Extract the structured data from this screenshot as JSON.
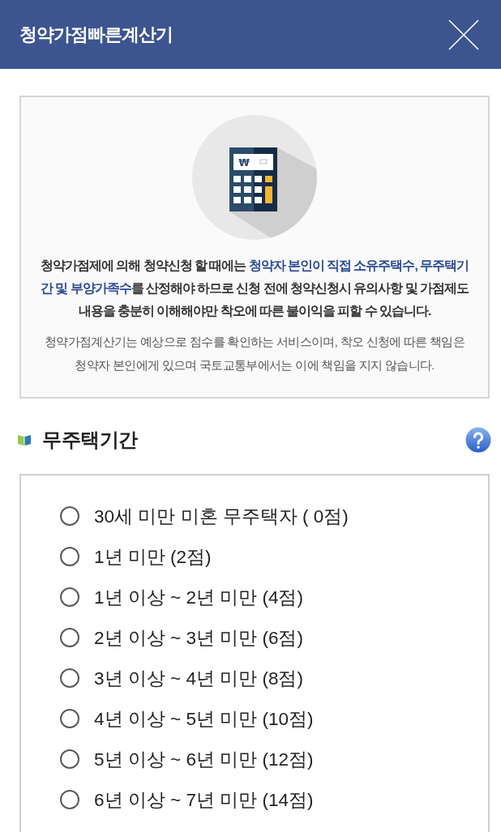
{
  "header": {
    "title": "청약가점빠른계산기"
  },
  "info": {
    "icon_symbol": "₩",
    "intro": {
      "segments": [
        {
          "text": "청약가점제에 의해 청약신청 할 때에는 ",
          "highlight": false
        },
        {
          "text": "청약자 본인이 직접 소유주택수, 무주택기간 및 부양가족수",
          "highlight": true
        },
        {
          "text": "를 산정해야 하므로 신청 전에 청약신청시 유의사항 및 가점제도 내용을 충분히 이해해야만 착오에 따른 불이익을 피할 수 있습니다.",
          "highlight": false
        }
      ]
    },
    "note": "청약가점계산기는 예상으로 점수를 확인하는 서비스이며, 착오 신청에 따른 책임은 청약자 본인에게 있으며 국토교통부에서는 이에 책임을 지지 않습니다."
  },
  "section": {
    "title": "무주택기간",
    "options": [
      {
        "label": "30세 미만 미혼 무주택자 ( 0점)",
        "selected": false
      },
      {
        "label": "1년 미만 (2점)",
        "selected": false
      },
      {
        "label": "1년 이상 ~ 2년 미만 (4점)",
        "selected": false
      },
      {
        "label": "2년 이상 ~ 3년 미만 (6점)",
        "selected": false
      },
      {
        "label": "3년 이상 ~ 4년 미만 (8점)",
        "selected": false
      },
      {
        "label": "4년 이상 ~ 5년 미만 (10점)",
        "selected": false
      },
      {
        "label": "5년 이상 ~ 6년 미만 (12점)",
        "selected": false
      },
      {
        "label": "6년 이상 ~ 7년 미만 (14점)",
        "selected": false
      }
    ]
  }
}
